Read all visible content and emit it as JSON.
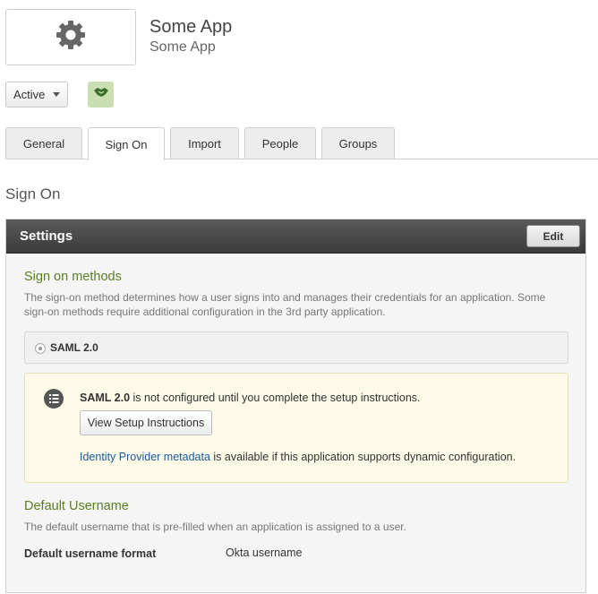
{
  "app": {
    "title": "Some App",
    "subtitle": "Some App",
    "logo_icon": "gear-icon"
  },
  "status": {
    "selected": "Active",
    "handshake_icon": "handshake-icon"
  },
  "tabs": [
    {
      "label": "General",
      "active": false
    },
    {
      "label": "Sign On",
      "active": true
    },
    {
      "label": "Import",
      "active": false
    },
    {
      "label": "People",
      "active": false
    },
    {
      "label": "Groups",
      "active": false
    }
  ],
  "section_title": "Sign On",
  "settings": {
    "title": "Settings",
    "edit_label": "Edit",
    "sign_on_methods": {
      "heading": "Sign on methods",
      "description": "The sign-on method determines how a user signs into and manages their credentials for an application. Some sign-on methods require additional configuration in the 3rd party application.",
      "option": "SAML 2.0"
    },
    "notice": {
      "icon": "list-icon",
      "bold": "SAML 2.0",
      "text": " is not configured until you complete the setup instructions.",
      "button_label": "View Setup Instructions",
      "link_text": "Identity Provider metadata",
      "link_suffix": " is available if this application supports dynamic configuration."
    },
    "default_username": {
      "heading": "Default Username",
      "description": "The default username that is pre-filled when an application is assigned to a user.",
      "label": "Default username format",
      "value": "Okta username"
    }
  },
  "colors": {
    "accent_green": "#5a7f22",
    "link_blue": "#1a5aa0",
    "header_dark": "#3a3a3a",
    "notice_bg": "#fdfbe8"
  }
}
